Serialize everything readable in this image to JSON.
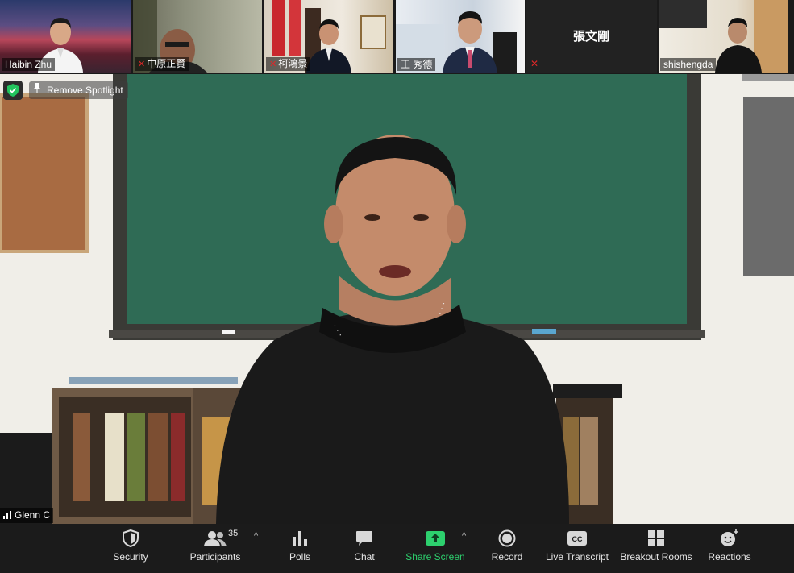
{
  "gallery": {
    "tiles": [
      {
        "name": "Haibin Zhu",
        "muted": false
      },
      {
        "name": "中原正賢",
        "muted": true
      },
      {
        "name": "柯鴻景",
        "muted": true
      },
      {
        "name": "王 秀德",
        "muted": false
      },
      {
        "name": "張文剛",
        "muted": true
      },
      {
        "name": "shishengda",
        "muted": false
      }
    ]
  },
  "spotlight": {
    "remove_label": "Remove Spotlight",
    "speaker_name": "Glenn C"
  },
  "toolbar": {
    "security": "Security",
    "participants": "Participants",
    "participant_count": "35",
    "polls": "Polls",
    "chat": "Chat",
    "share_screen": "Share Screen",
    "record": "Record",
    "live_transcript": "Live Transcript",
    "breakout_rooms": "Breakout Rooms",
    "reactions": "Reactions"
  },
  "colors": {
    "toolbar_bg": "#1b1b1b",
    "share_accent": "#2dd06e",
    "muted_red": "#e02828",
    "shield_green": "#22c55e"
  }
}
